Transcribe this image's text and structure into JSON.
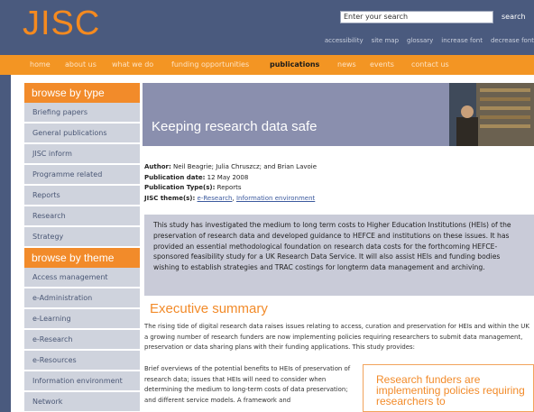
{
  "header": {
    "logo": "JISC",
    "search": {
      "value": "Enter your search",
      "button": "search"
    },
    "util_links": [
      "accessibility",
      "site map",
      "glossary",
      "increase font",
      "decrease font"
    ]
  },
  "nav": {
    "items": [
      "home",
      "about us",
      "what we do",
      "funding opportunities",
      "publications",
      "news",
      "events",
      "contact us"
    ],
    "active": "publications"
  },
  "sidebar": {
    "type_heading": "browse by type",
    "type_items": [
      "Briefing papers",
      "General publications",
      "JISC inform",
      "Programme related",
      "Reports",
      "Research",
      "Strategy"
    ],
    "theme_heading": "browse by theme",
    "theme_items": [
      "Access management",
      "e-Administration",
      "e-Learning",
      "e-Research",
      "e-Resources",
      "Information environment",
      "Network"
    ]
  },
  "hero": {
    "title": "Keeping research data safe"
  },
  "meta": {
    "author_label": "Author:",
    "author": "Neil Beagrie; Julia Chruszcz; and Brian Lavoie",
    "date_label": "Publication date:",
    "date": "12 May 2008",
    "type_label": "Publication Type(s):",
    "type": "Reports",
    "theme_label": "JISC theme(s):",
    "theme_links": [
      "e-Research",
      "Information environment"
    ]
  },
  "abstract": "This study has investigated the medium to long term costs to Higher Education Institutions (HEIs) of the preservation of research data and developed guidance to HEFCE and institutions on these issues. It has provided an essential methodological foundation on research data costs for the forthcoming HEFCE-sponsored feasibility study for a UK Research Data Service. It will also assist HEIs and funding bodies wishing to establish strategies and TRAC costings for longterm data management and archiving.",
  "executive": {
    "title": "Executive summary",
    "para1": "The rising tide of digital research data raises issues relating to access, curation and preservation for HEIs and within the UK a growing number of research funders are now implementing policies requiring researchers to submit data management, preservation or data sharing plans with their funding applications. This study provides:",
    "para2": "Brief overviews of the potential benefits to HEIs of preservation of research data; issues that HEIs will need to consider when determining the medium to long-term costs of data preservation; and different service models. A framework and",
    "quote": "Research funders are implementing policies requiring researchers to"
  }
}
